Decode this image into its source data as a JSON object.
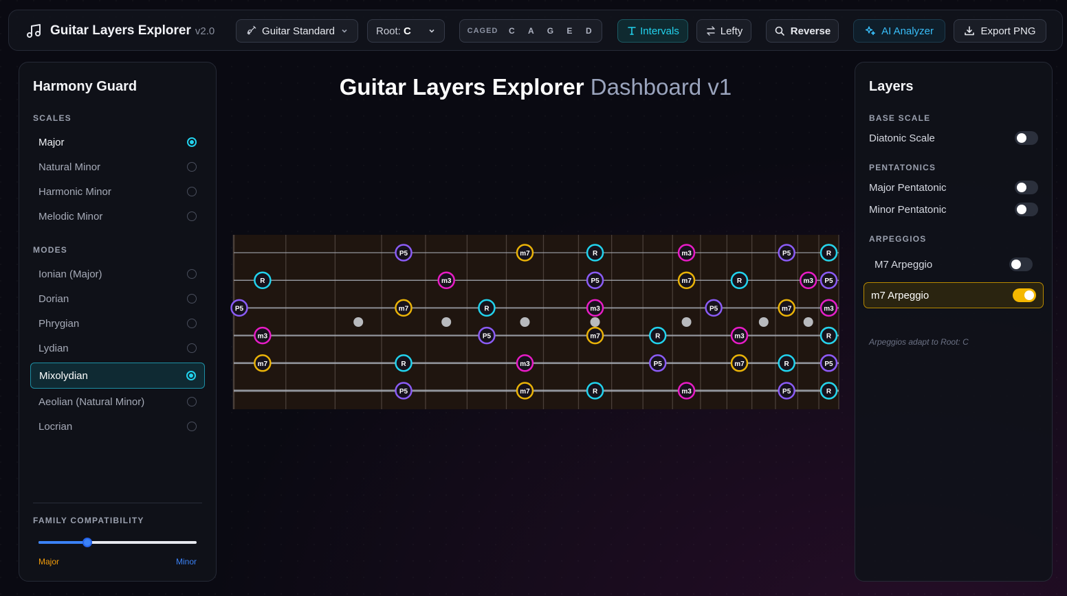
{
  "app": {
    "title": "Guitar Layers Explorer",
    "version": "v2.0"
  },
  "toolbar": {
    "tuning": "Guitar Standard",
    "root_label": "Root:",
    "root_value": "C",
    "caged_label": "CAGED",
    "caged_keys": [
      "C",
      "A",
      "G",
      "E",
      "D"
    ],
    "intervals": "Intervals",
    "lefty": "Lefty",
    "reverse": "Reverse",
    "ai": "AI Analyzer",
    "export": "Export PNG"
  },
  "left_panel": {
    "title": "Harmony Guard",
    "scales_label": "SCALES",
    "scales": [
      {
        "label": "Major",
        "selected": true
      },
      {
        "label": "Natural Minor",
        "selected": false
      },
      {
        "label": "Harmonic Minor",
        "selected": false
      },
      {
        "label": "Melodic Minor",
        "selected": false
      }
    ],
    "modes_label": "MODES",
    "modes": [
      {
        "label": "Ionian (Major)",
        "selected": false
      },
      {
        "label": "Dorian",
        "selected": false
      },
      {
        "label": "Phrygian",
        "selected": false
      },
      {
        "label": "Lydian",
        "selected": false
      },
      {
        "label": "Mixolydian",
        "selected": true
      },
      {
        "label": "Aeolian (Natural Minor)",
        "selected": false
      },
      {
        "label": "Locrian",
        "selected": false
      }
    ],
    "family_label": "FAMILY COMPATIBILITY",
    "family_value": 0.31,
    "family_left": "Major",
    "family_right": "Minor"
  },
  "main": {
    "heading_main": "Guitar Layers Explorer",
    "heading_sub": "Dashboard v1"
  },
  "right_panel": {
    "title": "Layers",
    "base_scale_label": "BASE SCALE",
    "diatonic": {
      "label": "Diatonic Scale",
      "on": false
    },
    "pentatonics_label": "PENTATONICS",
    "major_pent": {
      "label": "Major Pentatonic",
      "on": false
    },
    "minor_pent": {
      "label": "Minor Pentatonic",
      "on": false
    },
    "arpeggios_label": "ARPEGGIOS",
    "m7_major": {
      "label": "M7 Arpeggio",
      "on": false
    },
    "m7_minor": {
      "label": "m7 Arpeggio",
      "on": true
    },
    "note": "Arpeggios adapt to Root: C"
  },
  "colors": {
    "R": "#22d3ee",
    "P5": "#8b5cf6",
    "m7": "#eab308",
    "m3": "#e81cc6",
    "accent": "#22d3ee"
  },
  "fretboard": {
    "frets": 17,
    "inlay_frets": [
      3,
      5,
      7,
      9,
      12,
      15,
      17
    ],
    "notes": [
      {
        "s": 1,
        "f": 3,
        "t": "P5"
      },
      {
        "s": 1,
        "f": 6,
        "t": "m7"
      },
      {
        "s": 1,
        "f": 8,
        "t": "R"
      },
      {
        "s": 1,
        "f": 11,
        "t": "m3"
      },
      {
        "s": 1,
        "f": 15,
        "t": "P5"
      },
      {
        "s": 1,
        "f": 17,
        "t": "m7"
      },
      {
        "s": 1,
        "f": 18,
        "t": "R"
      },
      {
        "s": 2,
        "f": 0.5,
        "t": "R"
      },
      {
        "s": 2,
        "f": 4,
        "t": "m3"
      },
      {
        "s": 2,
        "f": 8,
        "t": "P5"
      },
      {
        "s": 2,
        "f": 11,
        "t": "m7"
      },
      {
        "s": 2,
        "f": 13,
        "t": "R"
      },
      {
        "s": 2,
        "f": 16,
        "t": "m3"
      },
      {
        "s": 2,
        "f": 18,
        "t": "P5"
      },
      {
        "s": 3,
        "f": 0,
        "t": "P5"
      },
      {
        "s": 3,
        "f": 3,
        "t": "m7"
      },
      {
        "s": 3,
        "f": 5,
        "t": "R"
      },
      {
        "s": 3,
        "f": 8,
        "t": "m3"
      },
      {
        "s": 3,
        "f": 12,
        "t": "P5"
      },
      {
        "s": 3,
        "f": 15,
        "t": "m7"
      },
      {
        "s": 3,
        "f": 17,
        "t": "R"
      },
      {
        "s": 3,
        "f": 18,
        "t": "m3"
      },
      {
        "s": 4,
        "f": 0.5,
        "t": "m3"
      },
      {
        "s": 4,
        "f": 5,
        "t": "P5"
      },
      {
        "s": 4,
        "f": 8,
        "t": "m7"
      },
      {
        "s": 4,
        "f": 10,
        "t": "R"
      },
      {
        "s": 4,
        "f": 13,
        "t": "m3"
      },
      {
        "s": 4,
        "f": 17,
        "t": "P5"
      },
      {
        "s": 4,
        "f": 18,
        "t": "m7"
      },
      {
        "s": 4,
        "f": 19,
        "t": "R"
      },
      {
        "s": 5,
        "f": 0.5,
        "t": "m7"
      },
      {
        "s": 5,
        "f": 3,
        "t": "R"
      },
      {
        "s": 5,
        "f": 6,
        "t": "m3"
      },
      {
        "s": 5,
        "f": 10,
        "t": "P5"
      },
      {
        "s": 5,
        "f": 13,
        "t": "m7"
      },
      {
        "s": 5,
        "f": 15,
        "t": "R"
      },
      {
        "s": 5,
        "f": 17,
        "t": "m3"
      },
      {
        "s": 5,
        "f": 19,
        "t": "P5"
      },
      {
        "s": 6,
        "f": 3,
        "t": "P5"
      },
      {
        "s": 6,
        "f": 6,
        "t": "m7"
      },
      {
        "s": 6,
        "f": 8,
        "t": "R"
      },
      {
        "s": 6,
        "f": 11,
        "t": "m3"
      },
      {
        "s": 6,
        "f": 15,
        "t": "P5"
      },
      {
        "s": 6,
        "f": 17,
        "t": "m7"
      },
      {
        "s": 6,
        "f": 18,
        "t": "R"
      }
    ]
  }
}
